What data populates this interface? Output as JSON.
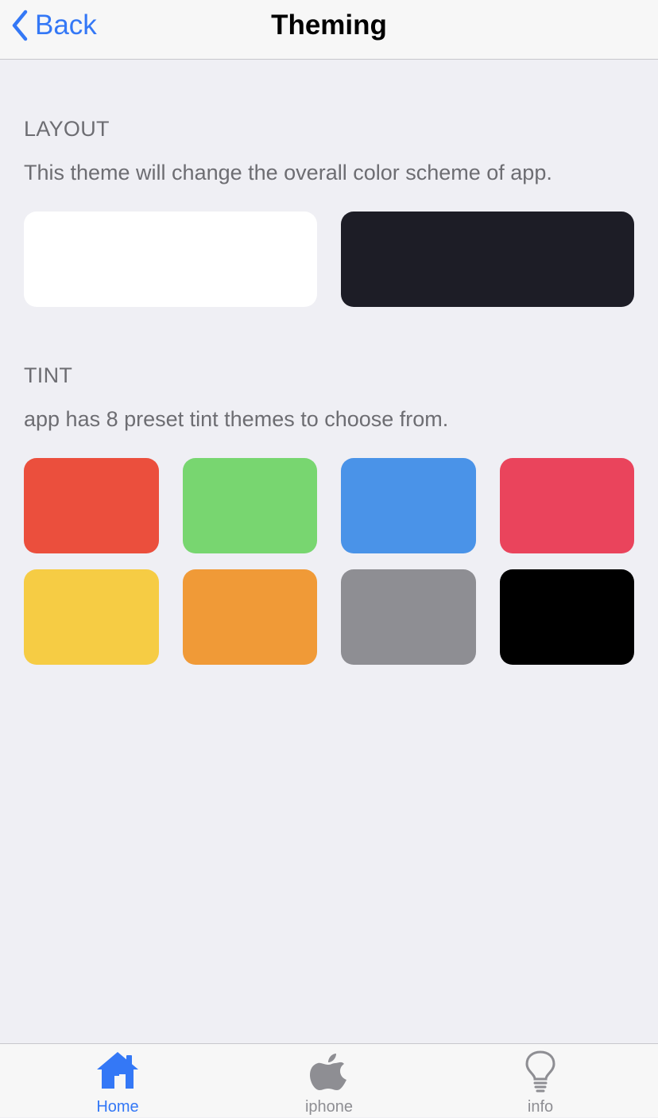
{
  "nav": {
    "back_label": "Back",
    "title": "Theming"
  },
  "colors": {
    "accent": "#3478f6",
    "background": "#efeff4",
    "secondary_text": "#6d6d72",
    "tab_inactive": "#8e8e93"
  },
  "layout_section": {
    "header": "LAYOUT",
    "description": "This theme will change the overall color scheme of app.",
    "options": [
      {
        "name": "light",
        "color": "#ffffff"
      },
      {
        "name": "dark",
        "color": "#1d1d26"
      }
    ]
  },
  "tint_section": {
    "header": "TINT",
    "description": "app has 8 preset tint themes to choose from.",
    "options": [
      {
        "name": "red",
        "color": "#eb4f3d"
      },
      {
        "name": "green",
        "color": "#78d670"
      },
      {
        "name": "blue",
        "color": "#4a93e8"
      },
      {
        "name": "pink",
        "color": "#ea445c"
      },
      {
        "name": "yellow",
        "color": "#f6cc44"
      },
      {
        "name": "orange",
        "color": "#f09a37"
      },
      {
        "name": "gray",
        "color": "#8e8e93"
      },
      {
        "name": "black",
        "color": "#000000"
      }
    ]
  },
  "tabbar": {
    "items": [
      {
        "label": "Home",
        "icon": "house-icon",
        "selected": true
      },
      {
        "label": "iphone",
        "icon": "apple-icon",
        "selected": false
      },
      {
        "label": "info",
        "icon": "lightbulb-icon",
        "selected": false
      }
    ]
  }
}
